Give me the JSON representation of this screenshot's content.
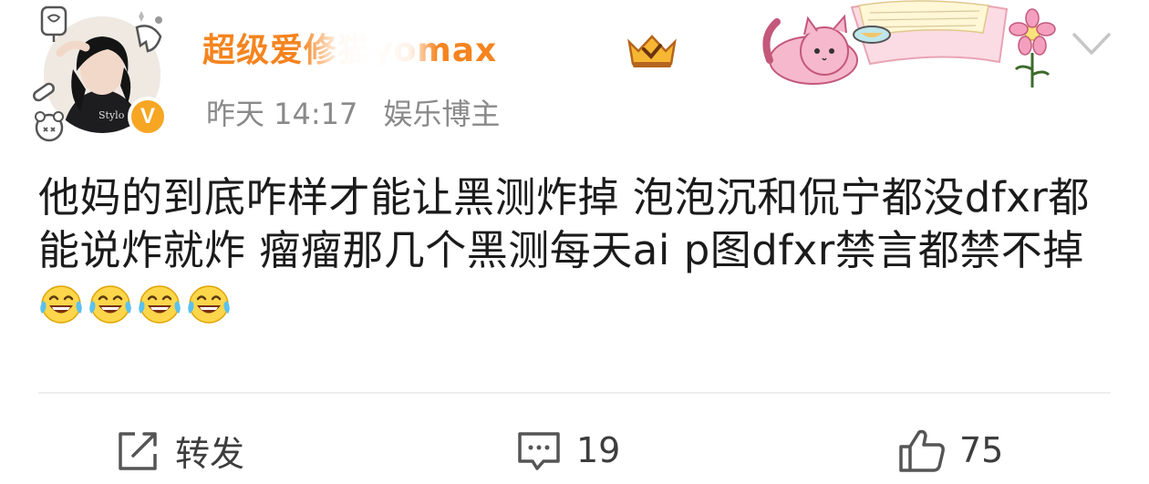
{
  "post": {
    "author": "超级爱修猫yomax",
    "time": "昨天 14:17",
    "role": "娱乐博主",
    "verified_mark": "V",
    "text": "他妈的到底咋样才能让黑测炸掉 泡泡沉和侃宁都没dfxr都能说炸就炸 瘤瘤那几个黑测每天ai p图dfxr禁言都禁不掉",
    "emoji_names": [
      "laughing-tears-emoji",
      "laughing-tears-emoji",
      "laughing-tears-emoji",
      "laughing-tears-emoji"
    ]
  },
  "actions": {
    "share_label": "转发",
    "comment_count": "19",
    "like_count": "75"
  },
  "colors": {
    "username": "#f5841f",
    "meta": "#8a8a8a",
    "badge": "#f6a623"
  },
  "icons": {
    "share": "share-icon",
    "comment": "comment-icon",
    "like": "thumbs-up-icon",
    "more": "chevron-down-icon"
  }
}
